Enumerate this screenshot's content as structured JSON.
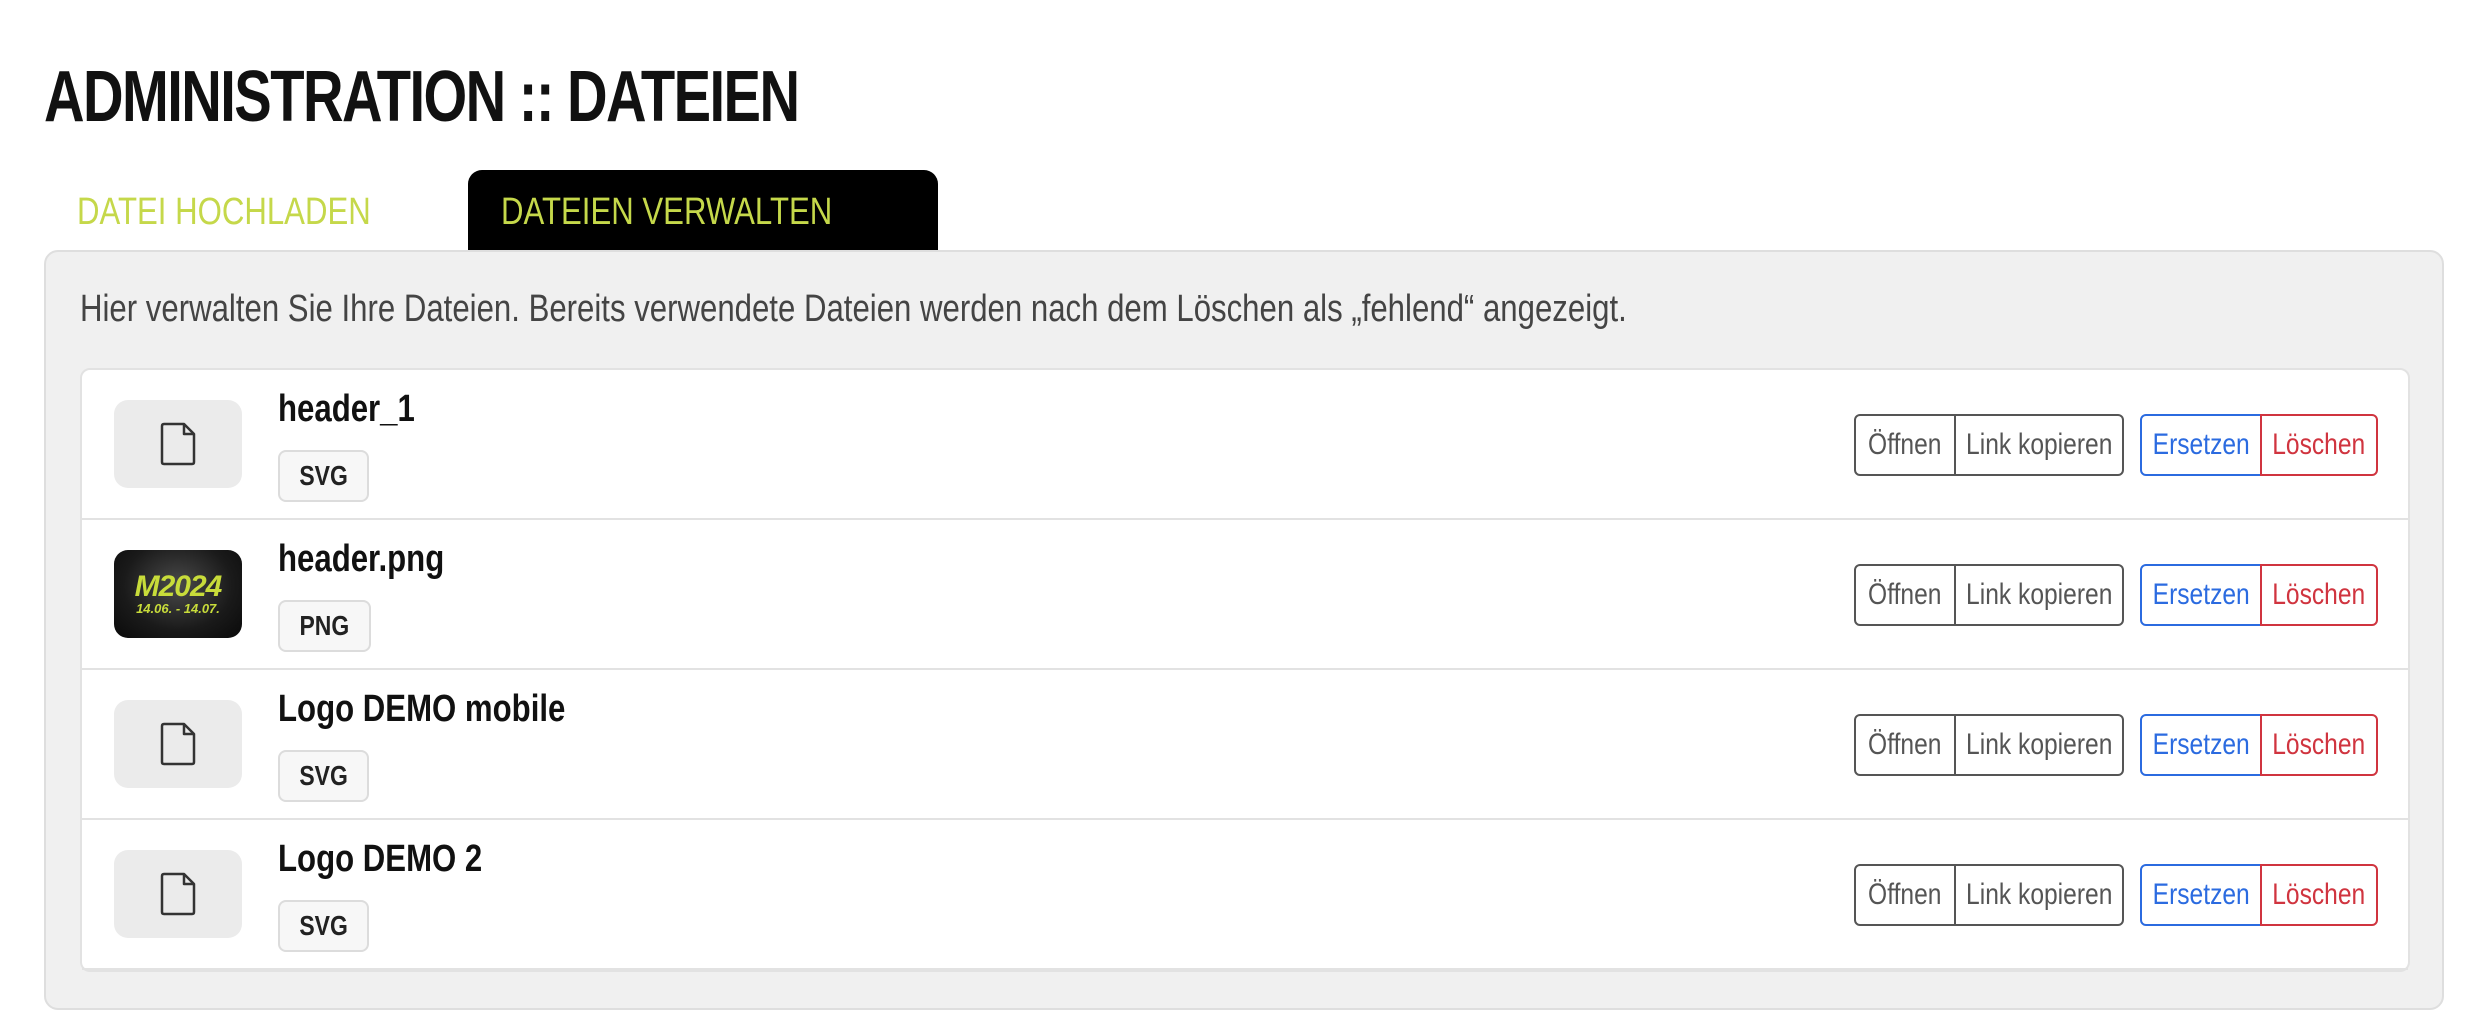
{
  "page": {
    "title": "ADMINISTRATION :: DATEIEN"
  },
  "tabs": [
    {
      "label": "DATEI HOCHLADEN",
      "active": false
    },
    {
      "label": "DATEIEN VERWALTEN",
      "active": true
    }
  ],
  "panel": {
    "description": "Hier verwalten Sie Ihre Dateien. Bereits verwendete Dateien werden nach dem Löschen als „fehlend“ angezeigt."
  },
  "actions": {
    "open": "Öffnen",
    "copy_link": "Link kopieren",
    "replace": "Ersetzen",
    "delete": "Löschen"
  },
  "files": [
    {
      "name": "header_1",
      "type": "SVG",
      "thumbnail": "file-icon"
    },
    {
      "name": "header.png",
      "type": "PNG",
      "thumbnail": "image",
      "image_text": "M2024",
      "image_subtext": "14.06. - 14.07."
    },
    {
      "name": "Logo DEMO mobile",
      "type": "SVG",
      "thumbnail": "file-icon"
    },
    {
      "name": "Logo DEMO 2",
      "type": "SVG",
      "thumbnail": "file-icon"
    }
  ],
  "colors": {
    "accent": "#c5d84a",
    "replace": "#2b6be0",
    "delete": "#d0343f",
    "tab_active_bg": "#000000"
  }
}
